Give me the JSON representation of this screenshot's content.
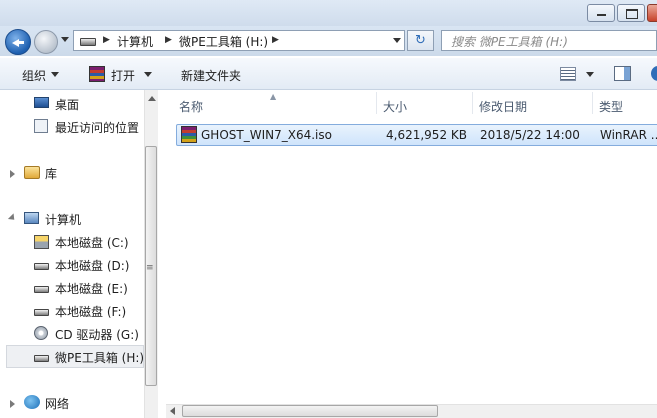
{
  "nav": {
    "breadcrumb": [
      "计算机",
      "微PE工具箱 (H:)"
    ],
    "refresh_glyph": "↻",
    "search_placeholder": "搜索 微PE工具箱 (H:)"
  },
  "toolbar": {
    "organize": "组织",
    "open": "打开",
    "new_folder": "新建文件夹"
  },
  "nav_pane": {
    "favorites": [
      {
        "label": "桌面",
        "icon": "desktop-icon"
      },
      {
        "label": "最近访问的位置",
        "icon": "recent-places-icon"
      }
    ],
    "libraries": {
      "label": "库",
      "icon": "library-icon"
    },
    "computer": {
      "label": "计算机",
      "icon": "computer-icon"
    },
    "drives": [
      {
        "label": "本地磁盘 (C:)",
        "icon": "system-drive-icon"
      },
      {
        "label": "本地磁盘 (D:)",
        "icon": "drive-icon"
      },
      {
        "label": "本地磁盘 (E:)",
        "icon": "drive-icon"
      },
      {
        "label": "本地磁盘 (F:)",
        "icon": "drive-icon"
      },
      {
        "label": "CD 驱动器 (G:)",
        "icon": "cd-drive-icon"
      },
      {
        "label": "微PE工具箱 (H:)",
        "icon": "drive-icon",
        "selected": true
      }
    ],
    "network": {
      "label": "网络",
      "icon": "network-icon"
    }
  },
  "columns": {
    "name": "名称",
    "size": "大小",
    "modified": "修改日期",
    "type": "类型"
  },
  "files": [
    {
      "name": "GHOST_WIN7_X64.iso",
      "size": "4,621,952 KB",
      "modified": "2018/5/22 14:00",
      "type": "WinRAR ...",
      "icon": "winrar-archive-icon",
      "selected": true
    }
  ],
  "colors": {
    "selection_fill": "#cfe4fb",
    "selection_border": "#84acdd",
    "chrome": "#d9e5f3"
  }
}
